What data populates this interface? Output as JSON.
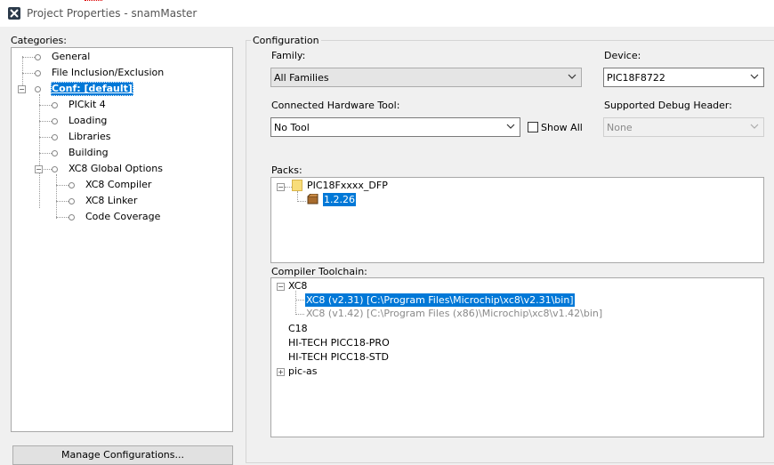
{
  "window": {
    "title": "Project Properties - snamMaster"
  },
  "categories": {
    "label": "Categories:",
    "items": [
      {
        "label": "General"
      },
      {
        "label": "File Inclusion/Exclusion"
      },
      {
        "label": "Conf: [default]"
      },
      {
        "label": "PICkit 4"
      },
      {
        "label": "Loading"
      },
      {
        "label": "Libraries"
      },
      {
        "label": "Building"
      },
      {
        "label": "XC8 Global Options"
      },
      {
        "label": "XC8 Compiler"
      },
      {
        "label": "XC8 Linker"
      },
      {
        "label": "Code Coverage"
      }
    ],
    "manage_button": "Manage Configurations..."
  },
  "configuration": {
    "group_label": "Configuration",
    "family": {
      "label": "Family:",
      "value": "All Families"
    },
    "device": {
      "label": "Device:",
      "value": "PIC18F8722"
    },
    "hardware_tool": {
      "label": "Connected Hardware Tool:",
      "value": "No Tool",
      "show_all": "Show All"
    },
    "debug_header": {
      "label": "Supported Debug Header:",
      "value": "None"
    },
    "packs": {
      "label": "Packs:",
      "root": "PIC18Fxxxx_DFP",
      "version": "1.2.26"
    },
    "toolchain": {
      "label": "Compiler Toolchain:",
      "xc8": "XC8",
      "xc8_selected": "XC8 (v2.31) [C:\\Program Files\\Microchip\\xc8\\v2.31\\bin]",
      "xc8_other": "XC8 (v1.42) [C:\\Program Files (x86)\\Microchip\\xc8\\v1.42\\bin]",
      "c18": "C18",
      "hitech_pro": "HI-TECH PICC18-PRO",
      "hitech_std": "HI-TECH PICC18-STD",
      "pic_as": "pic-as"
    }
  },
  "colors": {
    "selection": "#0078d7",
    "panel_border": "#a8a8a8"
  }
}
